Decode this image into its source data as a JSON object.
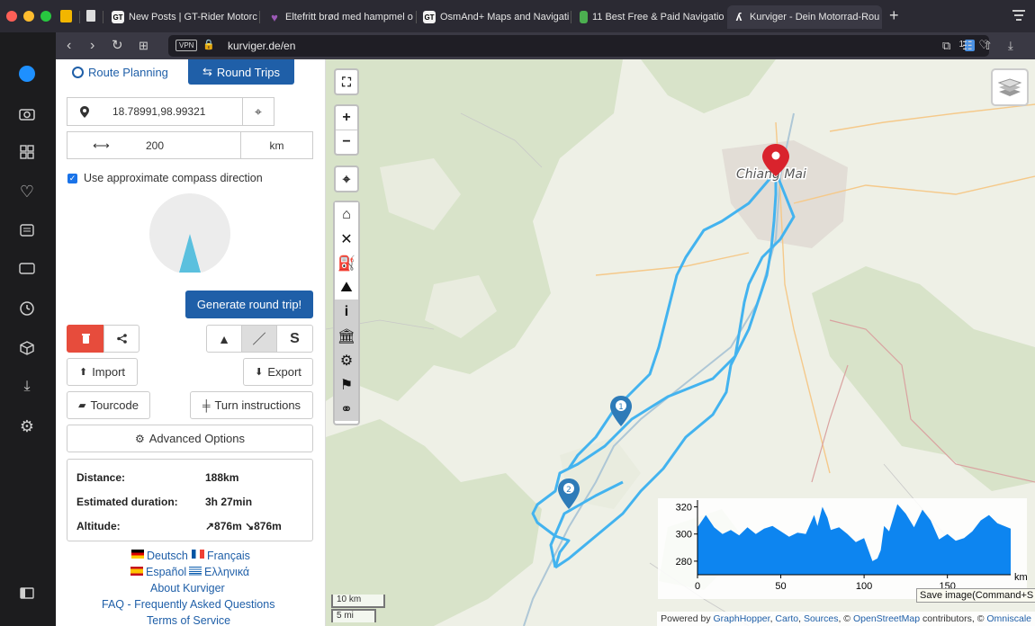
{
  "browser": {
    "tabs": [
      {
        "label": "New Posts | GT-Rider Motorc",
        "fav": "GT",
        "favcolor": "#f2f2f2"
      },
      {
        "label": "Eltefritt brød med hampmel o",
        "fav": "♥",
        "favcolor": "#7b4ca0"
      },
      {
        "label": "OsmAnd+ Maps and Navigatio",
        "fav": "GT",
        "favcolor": "#f2f2f2"
      },
      {
        "label": "11 Best Free & Paid Navigatio",
        "fav": "",
        "favcolor": "#4caf50"
      },
      {
        "label": "Kurviger - Dein Motorrad-Rou",
        "fav": "",
        "favcolor": "#ffffff"
      }
    ],
    "url": "kurviger.de/en",
    "vpn": "VPN",
    "tracker_count": "1"
  },
  "panel": {
    "tab_route": "Route Planning",
    "tab_round": "Round Trips",
    "location_value": "18.78991,98.99321",
    "distance_value": "200",
    "distance_unit": "km",
    "compass_label": "Use approximate compass direction",
    "generate_label": "Generate round trip!",
    "import_label": "Import",
    "export_label": "Export",
    "tourcode_label": "Tourcode",
    "turn_label": "Turn instructions",
    "advanced_label": "Advanced Options",
    "stats": [
      {
        "label": "Distance:",
        "value": "188km"
      },
      {
        "label": "Estimated duration:",
        "value": "3h 27min"
      },
      {
        "label": "Altitude:",
        "value": "↗876m ↘876m"
      }
    ],
    "languages_row1": [
      "Deutsch",
      "Français"
    ],
    "languages_row2": [
      "Español",
      "Ελληνικά"
    ],
    "about": "About Kurviger",
    "faq": "FAQ - Frequently Asked Questions",
    "terms": "Terms of Service"
  },
  "map": {
    "city_label": "Chiang Mai",
    "marker1": "1",
    "marker2": "2",
    "scale_km": "10 km",
    "scale_mi": "5 mi",
    "tooltip": "Save image(Command+S",
    "attribution_prefix": "Powered by",
    "attribution_links": [
      "GraphHopper",
      "Carto",
      "Sources"
    ],
    "attribution_osm": "OpenStreetMap",
    "attribution_mid": "contributors, ©",
    "attribution_end": "Omniscale",
    "elevation": {
      "y_ticks": [
        "320",
        "300",
        "280"
      ],
      "x_ticks": [
        "0",
        "50",
        "100",
        "150"
      ],
      "unit": "km"
    }
  },
  "chart_data": {
    "type": "area",
    "x": [
      0,
      5,
      10,
      15,
      20,
      25,
      30,
      35,
      40,
      45,
      50,
      55,
      60,
      65,
      70,
      72,
      75,
      78,
      80,
      85,
      90,
      95,
      100,
      105,
      108,
      110,
      112,
      115,
      120,
      125,
      130,
      135,
      140,
      145,
      150,
      155,
      160,
      165,
      170,
      175,
      180,
      188
    ],
    "series": [
      {
        "values": [
          305,
          314,
          305,
          300,
          303,
          299,
          305,
          300,
          304,
          306,
          302,
          298,
          301,
          300,
          314,
          306,
          320,
          312,
          303,
          305,
          300,
          294,
          297,
          280,
          282,
          288,
          306,
          302,
          322,
          315,
          305,
          318,
          310,
          296,
          300,
          295,
          297,
          302,
          310,
          314,
          308,
          304
        ]
      }
    ],
    "xlabel": "km",
    "ylim": [
      270,
      325
    ],
    "xlim": [
      0,
      188
    ],
    "color": "#0d85f0"
  },
  "colors": {
    "accent": "#1f5fa8",
    "active_tab_bg": "#1f5fa8",
    "delete_red": "#e74c3c",
    "route_blue": "#43b3ef",
    "marker_red": "#d9232d",
    "marker_blue": "#2e7bb8",
    "compass_fill": "#5bc0de"
  },
  "sidebar_icons": [
    "messenger-icon",
    "camera-icon",
    "grid-icon",
    "heart-icon",
    "news-icon",
    "cast-icon",
    "history-icon",
    "box-icon",
    "download-icon",
    "settings-icon",
    "sidebar-toggle-icon"
  ]
}
